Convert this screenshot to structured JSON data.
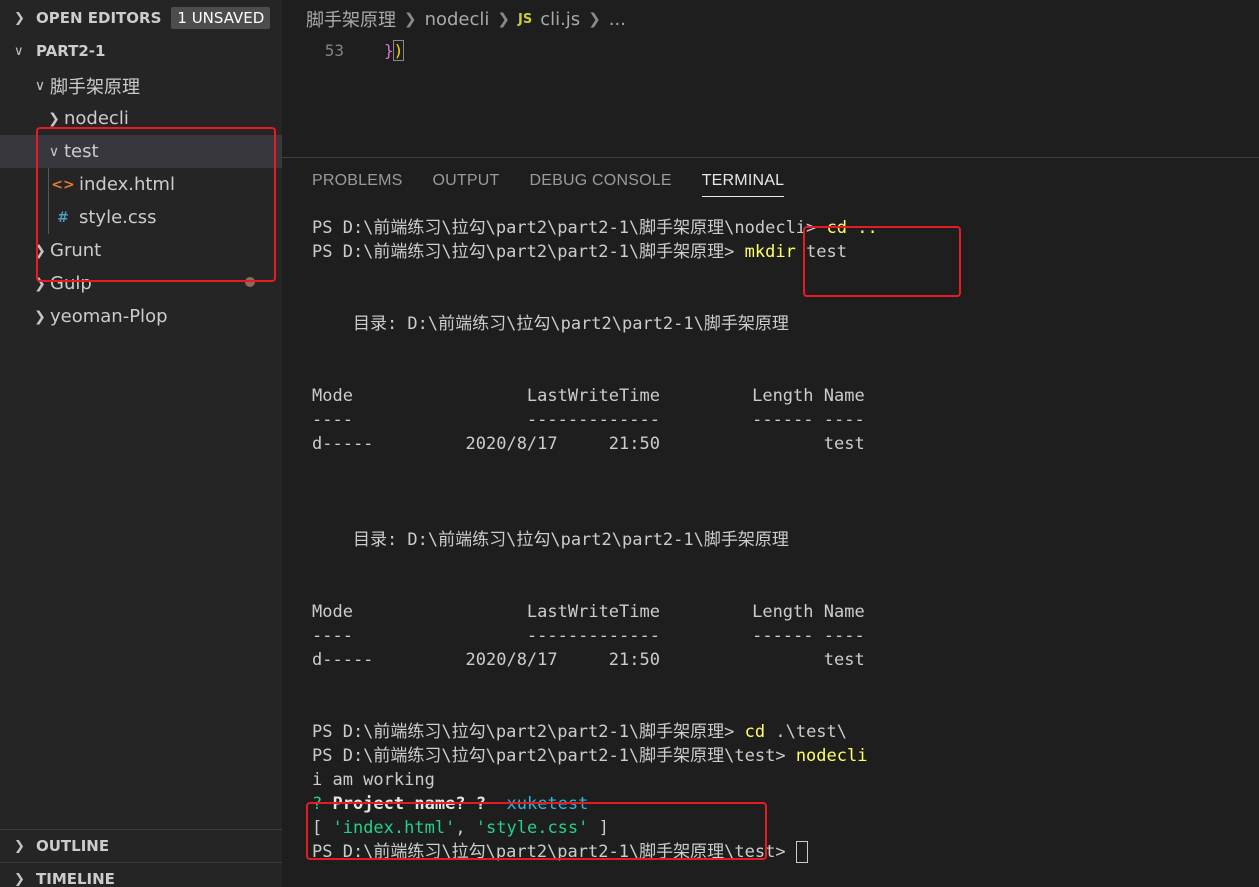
{
  "sidebar": {
    "open_editors": {
      "label": "OPEN EDITORS",
      "badge": "1 UNSAVED"
    },
    "project": "PART2-1",
    "tree": [
      {
        "label": "脚手架原理",
        "icon": "chevron-down-icon"
      },
      {
        "label": "nodecli",
        "icon": "chevron-right-icon"
      },
      {
        "label": "test",
        "icon": "chevron-down-icon"
      },
      {
        "label": "index.html",
        "icon": "html-file-icon",
        "glyph": "<>"
      },
      {
        "label": "style.css",
        "icon": "css-file-icon",
        "glyph": "#"
      },
      {
        "label": "Grunt",
        "icon": "chevron-right-icon"
      },
      {
        "label": "Gulp",
        "icon": "chevron-right-icon"
      },
      {
        "label": "yeoman-Plop",
        "icon": "chevron-right-icon"
      }
    ],
    "outline": "OUTLINE",
    "timeline": "TIMELINE"
  },
  "editor": {
    "breadcrumb": [
      "脚手架原理",
      "nodecli",
      "cli.js",
      "..."
    ],
    "js_badge": "JS",
    "line_number": "53",
    "code_brace": "}",
    "code_paren": ")"
  },
  "panel": {
    "tabs": [
      "PROBLEMS",
      "OUTPUT",
      "DEBUG CONSOLE",
      "TERMINAL"
    ],
    "active_tab": "TERMINAL"
  },
  "terminal": {
    "prompt_nodecli": "PS D:\\前端练习\\拉勾\\part2\\part2-1\\脚手架原理\\nodecli> ",
    "cmd_cd_up": "cd ..",
    "prompt_root": "PS D:\\前端练习\\拉勾\\part2\\part2-1\\脚手架原理> ",
    "cmd_mkdir": "mkdir",
    "cmd_mkdir_arg": " test",
    "dir_line": "    目录: D:\\前端练习\\拉勾\\part2\\part2-1\\脚手架原理",
    "header_line": "Mode                 LastWriteTime         Length Name",
    "dash_line": "----                 -------------         ------ ----",
    "row_line": "d-----         2020/8/17     21:50                test",
    "cmd_cd_test": "cd",
    "cmd_cd_test_arg": " .\\test\\",
    "prompt_test": "PS D:\\前端练习\\拉勾\\part2\\part2-1\\脚手架原理\\test> ",
    "cmd_nodecli": "nodecli",
    "output_working": "i am working",
    "question_mark": "?",
    "question_text": " Project name? ? ",
    "answer": " xuketest",
    "array_open": "[ ",
    "file1": "'index.html'",
    "comma": ", ",
    "file2": "'style.css'",
    "array_close": " ]"
  },
  "colors": {
    "accent_red": "#e51c23",
    "terminal_yellow": "#ffff66",
    "terminal_green": "#23d18b",
    "terminal_cyan": "#29b8db"
  }
}
